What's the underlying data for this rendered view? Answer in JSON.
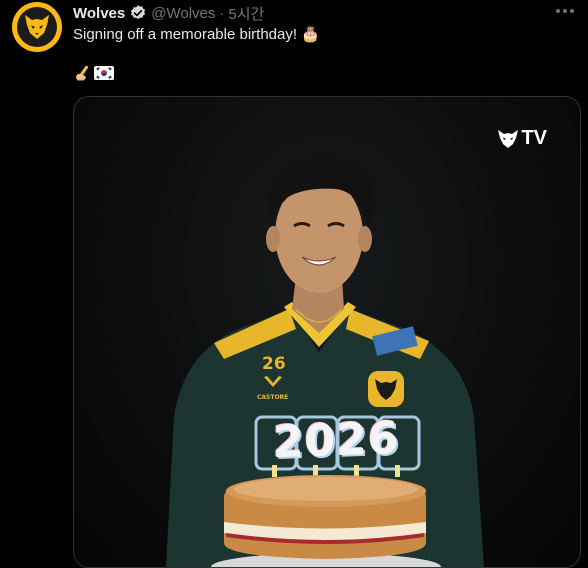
{
  "tweet": {
    "author_name": "Wolves",
    "handle": "@Wolves",
    "separator": "·",
    "time": "5시간",
    "text": "Signing off a memorable birthday! 🎂",
    "emoji_line": "✍️🇰🇷"
  },
  "media": {
    "brand_label": "TV",
    "jersey_number": "26",
    "sponsor_text": "CASTORE",
    "cake_number": "2026"
  },
  "colors": {
    "background": "#000000",
    "text_primary": "#e7e9ea",
    "text_secondary": "#71767b",
    "wolves_gold": "#fdb913",
    "shirt_green": "#1d3530"
  },
  "icons": [
    "wolves-logo-icon",
    "verified-badge-icon",
    "more-icon",
    "writing-hand-icon",
    "korea-flag-icon",
    "wolves-tv-logo-icon"
  ]
}
